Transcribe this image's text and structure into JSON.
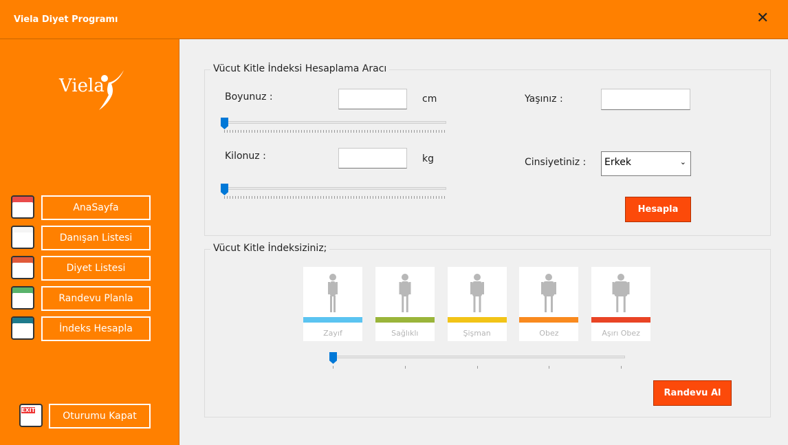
{
  "window": {
    "title": "Viela Diyet Programı",
    "close_icon": "close-icon"
  },
  "sidebar": {
    "logo_text": "Viela",
    "items": [
      {
        "label": "AnaSayfa",
        "icon": "home-browser-icon",
        "color": "#e94b4b"
      },
      {
        "label": "Danışan Listesi",
        "icon": "checklist-icon",
        "color": "#f5f5f5"
      },
      {
        "label": "Diyet Listesi",
        "icon": "diet-clipboard-icon",
        "color": "#e05a3a"
      },
      {
        "label": "Randevu Planla",
        "icon": "calendar-icon",
        "color": "#59b36b"
      },
      {
        "label": "İndeks Hesapla",
        "icon": "bmi-calculator-icon",
        "color": "#1d7a8c"
      }
    ],
    "logout": {
      "label": "Oturumu Kapat",
      "icon": "exit-door-icon"
    }
  },
  "calc": {
    "title": "Vücut Kitle İndeksi Hesaplama Aracı",
    "height_label": "Boyunuz :",
    "height_value": "",
    "height_unit": "cm",
    "height_slider": 0,
    "weight_label": "Kilonuz :",
    "weight_value": "",
    "weight_unit": "kg",
    "weight_slider": 0,
    "age_label": "Yaşınız :",
    "age_value": "",
    "gender_label": "Cinsiyetiniz :",
    "gender_value": "Erkek",
    "calculate_label": "Hesapla"
  },
  "result": {
    "title": "Vücut Kitle İndeksiziniz;",
    "categories": [
      {
        "label": "Zayıf",
        "color": "#5bc4f1"
      },
      {
        "label": "Sağlıklı",
        "color": "#9ab53a"
      },
      {
        "label": "Şişman",
        "color": "#f2c417"
      },
      {
        "label": "Obez",
        "color": "#f98a1f"
      },
      {
        "label": "Aşırı Obez",
        "color": "#e94425"
      }
    ],
    "level_slider": 0,
    "level_max": 4,
    "appointment_label": "Randevu Al"
  }
}
